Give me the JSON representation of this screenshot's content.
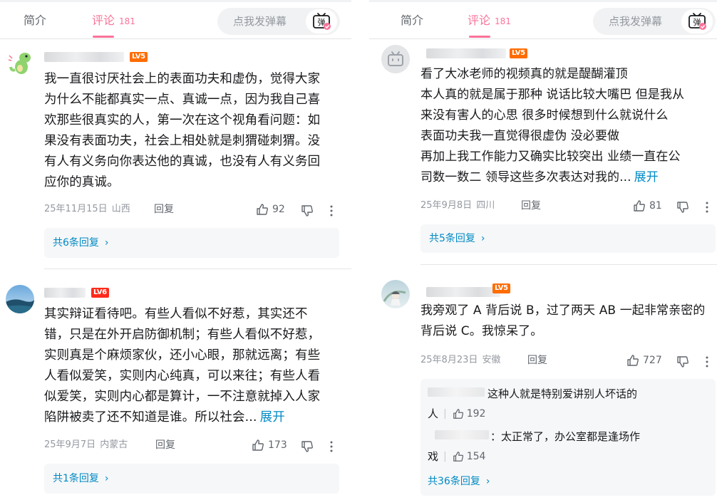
{
  "tabs": {
    "intro": "简介",
    "comments": "评论",
    "comment_count": "181"
  },
  "danmu": {
    "placeholder": "点我发弹幕",
    "button_glyph": "弹"
  },
  "left": {
    "comments": [
      {
        "level": "LV5",
        "lines": [
          "我一直很讨厌社会上的表面功夫和虚伪，觉得大家",
          "为什么不能都真实一点、真诚一点，因为我自己喜",
          "欢那些很真实的人，第一次在这个视角看问题：如",
          "果没有表面功夫，社会上相处就是刺猬碰刺猬。没",
          "有人有义务向你表达他的真诚，也没有人有义务回",
          "应你的真诚。"
        ],
        "date": "25年11月15日",
        "location": "山西",
        "reply_label": "回复",
        "likes": "92",
        "replies_summary": "共6条回复"
      },
      {
        "level": "LV6",
        "lines": [
          "其实辩证看待吧。有些人看似不好惹，其实还不",
          "错，只是在外开启防御机制；有些人看似不好惹，",
          "实则真是个麻烦家伙，还小心眼，那就远离；有些",
          "人看似爱笑，实则内心纯真，可以来往；有些人看",
          "似爱笑，实则内心都是算计，一不注意就掉入人家",
          "陷阱被卖了还不知道是谁。所以社会..."
        ],
        "expand": "展开",
        "date": "25年9月7日",
        "location": "内蒙古",
        "reply_label": "回复",
        "likes": "173",
        "replies_summary": "共1条回复"
      }
    ]
  },
  "right": {
    "comments": [
      {
        "level": "LV5",
        "lines": [
          "看了大冰老师的视频真的就是醍醐灌顶",
          "本人真的就是属于那种 说话比较大嘴巴 但是我从",
          "来没有害人的心思 很多时候想到什么就说什么",
          "表面功夫我一直觉得很虚伪 没必要做",
          "再加上我工作能力又确实比较突出 业绩一直在公",
          "司数一数二 领导这些多次表达对我的..."
        ],
        "expand": "展开",
        "date": "25年9月8日",
        "location": "四川",
        "reply_label": "回复",
        "likes": "81",
        "replies_summary": "共5条回复"
      },
      {
        "level": "LV5",
        "lines": [
          "我旁观了 A 背后说 B，过了两天 AB 一起非常亲密的",
          "背后说 C。我惊呆了。"
        ],
        "date": "25年8月23日",
        "location": "安徽",
        "reply_label": "回复",
        "likes": "727",
        "sub_replies": [
          {
            "text_a": "这种人就是特别爱讲别人坏话的",
            "text_b": "人",
            "likes": "192"
          },
          {
            "text_a": "：太正常了，办公室都是逢场作",
            "text_b": "戏",
            "likes": "154"
          }
        ],
        "replies_summary": "共36条回复"
      }
    ]
  },
  "colors": {
    "pink": "#fb7299",
    "link": "#008ac5",
    "lv5": "#ff6c00",
    "lv6": "#ff2a1a"
  }
}
